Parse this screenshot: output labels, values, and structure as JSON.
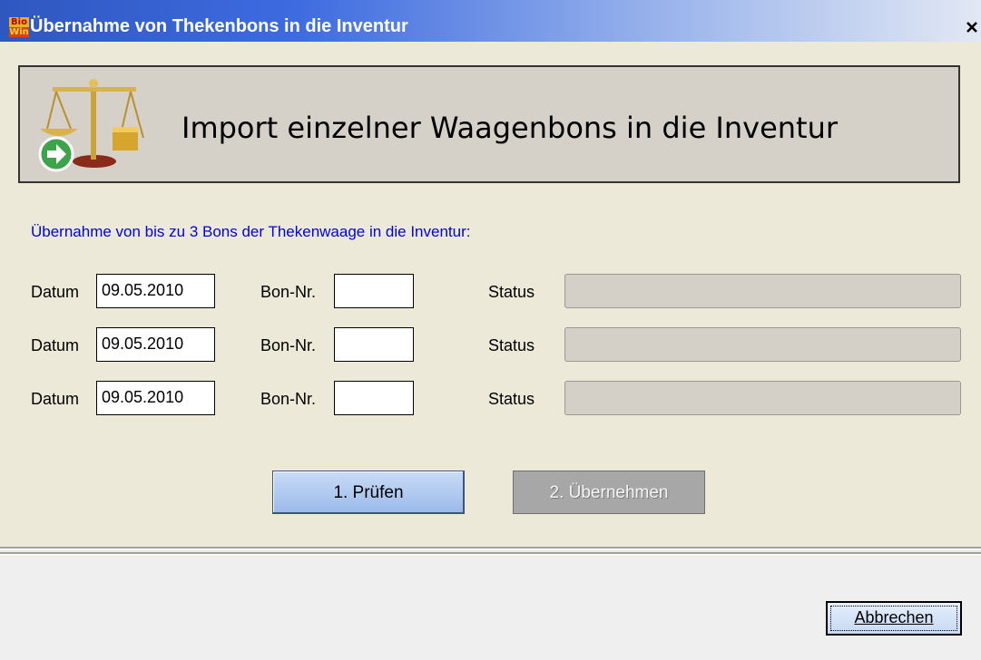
{
  "window": {
    "icon_text_line1": "Bio",
    "icon_text_line2": "Win",
    "title": "Übernahme von Thekenbons in die Inventur",
    "close_glyph": "✕"
  },
  "header": {
    "title": "Import einzelner Waagenbons in die Inventur",
    "icon": "scale-with-green-arrow-icon"
  },
  "intro_text": "Übernahme von bis zu 3 Bons der Thekenwaage in die Inventur:",
  "rows": [
    {
      "date_label": "Datum",
      "date_value": "09.05.2010",
      "bon_label": "Bon-Nr.",
      "bon_value": "",
      "status_label": "Status",
      "status_value": ""
    },
    {
      "date_label": "Datum",
      "date_value": "09.05.2010",
      "bon_label": "Bon-Nr.",
      "bon_value": "",
      "status_label": "Status",
      "status_value": ""
    },
    {
      "date_label": "Datum",
      "date_value": "09.05.2010",
      "bon_label": "Bon-Nr.",
      "bon_value": "",
      "status_label": "Status",
      "status_value": ""
    }
  ],
  "buttons": {
    "check_label": "1. Prüfen",
    "take_over_label": "2. Übernehmen",
    "cancel_label": "Abbrechen"
  },
  "colors": {
    "intro_text": "#0000dd",
    "title_bar": "#2f57c0",
    "dialog_background": "#ece9d8"
  }
}
